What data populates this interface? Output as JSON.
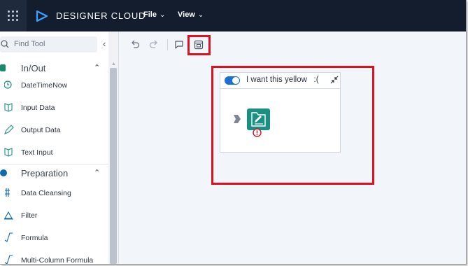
{
  "app": {
    "name": "DESIGNER CLOUD",
    "menus": [
      {
        "label": "File",
        "icon": "chevron-down-icon"
      },
      {
        "label": "View",
        "icon": "chevron-down-icon"
      }
    ]
  },
  "sidebar": {
    "search_placeholder": "Find Tool",
    "sections": [
      {
        "label": "In/Out",
        "tools": [
          "DateTimeNow",
          "Input Data",
          "Output Data",
          "Text Input"
        ]
      },
      {
        "label": "Preparation",
        "tools": [
          "Data Cleansing",
          "Filter",
          "Formula",
          "Multi-Column Formula"
        ]
      }
    ]
  },
  "toolbar": {
    "buttons": [
      "undo-icon",
      "redo-icon",
      "comment-icon",
      "container-icon"
    ]
  },
  "canvas": {
    "container": {
      "title": "I want this yellow   :(",
      "enabled": true
    },
    "tool": {
      "icon": "output-data-icon",
      "status": "error-icon"
    }
  },
  "colors": {
    "topbar": "#141d2e",
    "accent_blue": "#1b6fd1",
    "tool_green": "#1c8f83",
    "highlight_red": "#e0101f",
    "warning_red": "#d0182b"
  }
}
